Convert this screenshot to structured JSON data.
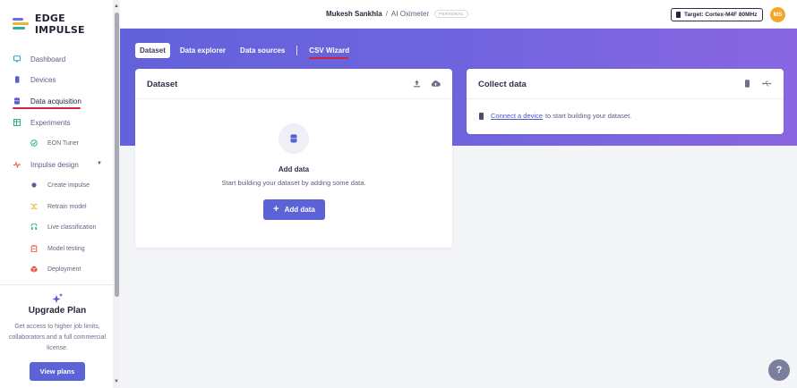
{
  "brand": {
    "name": "EDGE IMPULSE"
  },
  "sidebar": {
    "items": [
      {
        "label": "Dashboard",
        "icon": "monitor-icon"
      },
      {
        "label": "Devices",
        "icon": "device-icon"
      },
      {
        "label": "Data acquisition",
        "icon": "database-icon"
      },
      {
        "label": "Experiments",
        "icon": "table-icon"
      },
      {
        "label": "EON Tuner",
        "icon": "tuner-icon"
      },
      {
        "label": "Impulse design",
        "icon": "pulse-icon"
      },
      {
        "label": "Create impulse",
        "icon": "dot-icon"
      },
      {
        "label": "Retrain model",
        "icon": "shuffle-icon"
      },
      {
        "label": "Live classification",
        "icon": "live-icon"
      },
      {
        "label": "Model testing",
        "icon": "clipboard-icon"
      },
      {
        "label": "Deployment",
        "icon": "package-icon"
      }
    ],
    "upgrade": {
      "title": "Upgrade Plan",
      "description": "Get access to higher job limits, collaborators and a full commercial license.",
      "button": "View plans"
    }
  },
  "header": {
    "user": "Mukesh Sankhla",
    "separator": "/",
    "project": "AI Oximeter",
    "badge": "PERSONAL",
    "target": "Target: Cortex-M4F 80MHz",
    "avatar": "MS"
  },
  "tabs": [
    {
      "label": "Dataset",
      "active": true
    },
    {
      "label": "Data explorer",
      "active": false
    },
    {
      "label": "Data sources",
      "active": false
    },
    {
      "label": "CSV Wizard",
      "active": false
    }
  ],
  "dataset_card": {
    "title": "Dataset",
    "empty_title": "Add data",
    "empty_desc": "Start building your dataset by adding some data.",
    "button": "Add data"
  },
  "collect_card": {
    "title": "Collect data",
    "link": "Connect a device",
    "text": "to start building your dataset."
  },
  "help": {
    "label": "?"
  },
  "colors": {
    "accent": "#5b63d6",
    "highlight": "#d6203f",
    "avatar": "#f2a62b"
  }
}
